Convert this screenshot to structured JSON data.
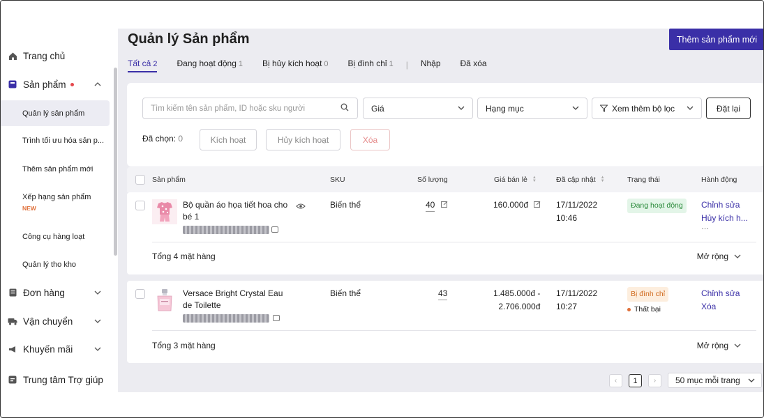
{
  "sidebar": {
    "items": [
      {
        "label": "Trang chủ",
        "icon": "home-icon"
      },
      {
        "label": "Sản phẩm",
        "icon": "product-box-icon",
        "notice": true
      },
      {
        "label": "Đơn hàng",
        "icon": "order-icon"
      },
      {
        "label": "Vận chuyển",
        "icon": "truck-icon"
      },
      {
        "label": "Khuyến mãi",
        "icon": "megaphone-icon"
      },
      {
        "label": "Trung tâm Trợ giúp",
        "icon": "help-icon"
      }
    ],
    "sub": [
      {
        "label": "Quản lý sản phẩm"
      },
      {
        "label": "Trình tối ưu hóa sản p..."
      },
      {
        "label": "Thêm sản phẩm mới"
      },
      {
        "label": "Xếp hạng sản phẩm",
        "badge": "NEW"
      },
      {
        "label": "Công cụ hàng loạt"
      },
      {
        "label": "Quản lý tho kho"
      }
    ]
  },
  "page": {
    "title": "Quản lý Sản phẩm",
    "add_button": "Thêm sản phẩm mới"
  },
  "tabs": [
    {
      "label": "Tất cả",
      "count": "2"
    },
    {
      "label": "Đang hoạt động",
      "count": "1"
    },
    {
      "label": "Bị hủy kích hoạt",
      "count": "0"
    },
    {
      "label": "Bị đình chỉ",
      "count": "1"
    },
    {
      "label": "Nhập",
      "count": ""
    },
    {
      "label": "Đã xóa",
      "count": ""
    }
  ],
  "filters": {
    "search_placeholder": "Tìm kiếm tên sản phẩm, ID hoặc sku người",
    "price": "Giá",
    "category": "Hạng mục",
    "more_filters": "Xem thêm bộ lọc",
    "reset": "Đặt lại",
    "selected_label": "Đã chọn:",
    "selected_count": "0",
    "activate": "Kích hoạt",
    "deactivate": "Hủy kích hoạt",
    "delete": "Xóa"
  },
  "table": {
    "headers": {
      "product": "Sản phẩm",
      "sku": "SKU",
      "quantity": "Số lượng",
      "price": "Giá bán lẻ",
      "updated": "Đã cập nhật",
      "status": "Trạng thái",
      "actions": "Hành động"
    },
    "rows": [
      {
        "name": "Bộ quần áo họa tiết hoa cho bé 1",
        "sku": "Biến thể",
        "quantity": "40",
        "price": "160.000đ",
        "date": "17/11/2022",
        "time": "10:46",
        "status": "Đang hoạt động",
        "action1": "Chỉnh sửa",
        "action2": "Hủy kích h...",
        "total": "Tổng 4 mặt hàng",
        "expand": "Mở rộng"
      },
      {
        "name": "Versace Bright Crystal Eau de Toilette",
        "sku": "Biến thể",
        "quantity": "43",
        "price_min": "1.485.000đ -",
        "price_max": "2.706.000đ",
        "date": "17/11/2022",
        "time": "10:27",
        "status": "Bị đình chỉ",
        "sub_status": "Thất bại",
        "action1": "Chỉnh sửa",
        "action2": "Xóa",
        "total": "Tổng 3 mặt hàng",
        "expand": "Mở rộng"
      }
    ]
  },
  "pagination": {
    "current_page": "1",
    "per_page": "50 mục mỗi trang"
  },
  "colors": {
    "accent": "#3a2fa7",
    "active_status": "#2a8a3a",
    "suspended_status": "#d06a1e"
  }
}
